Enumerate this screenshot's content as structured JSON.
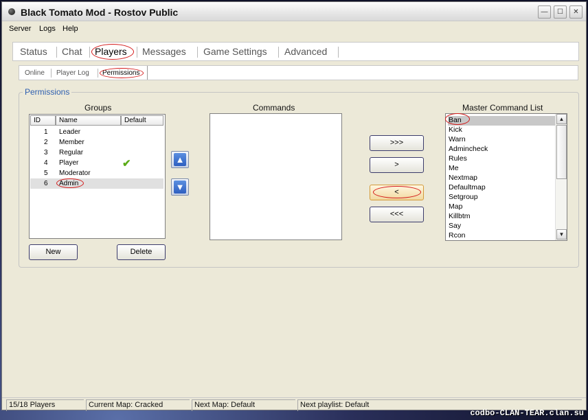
{
  "window": {
    "title": "Black Tomato Mod - Rostov Public",
    "min_glyph": "—",
    "max_glyph": "☐",
    "close_glyph": "✕"
  },
  "menu": [
    "Server",
    "Logs",
    "Help"
  ],
  "main_tabs": [
    "Status",
    "Chat",
    "Players",
    "Messages",
    "Game Settings",
    "Advanced"
  ],
  "sub_tabs": [
    "Online",
    "Player Log",
    "Permissions"
  ],
  "permissions": {
    "legend": "Permissions",
    "groups": {
      "label": "Groups",
      "columns": [
        "ID",
        "Name",
        "Default"
      ],
      "rows": [
        {
          "id": "1",
          "name": "Leader",
          "default": false
        },
        {
          "id": "2",
          "name": "Member",
          "default": false
        },
        {
          "id": "3",
          "name": "Regular",
          "default": false
        },
        {
          "id": "4",
          "name": "Player",
          "default": true
        },
        {
          "id": "5",
          "name": "Moderator",
          "default": false
        },
        {
          "id": "6",
          "name": "Admin",
          "default": false
        }
      ],
      "selected_row": 5,
      "check_glyph": "✔",
      "up_glyph": "▲",
      "down_glyph": "▼",
      "new_label": "New",
      "delete_label": "Delete"
    },
    "commands": {
      "label": "Commands",
      "items": []
    },
    "transfer_buttons": [
      ">>>",
      ">",
      "<",
      "<<<"
    ],
    "master": {
      "label": "Master Command List",
      "items": [
        "Ban",
        "Kick",
        "Warn",
        "Admincheck",
        "Rules",
        "Me",
        "Nextmap",
        "Defaultmap",
        "Setgroup",
        "Map",
        "Killbtm",
        "Say",
        "Rcon"
      ],
      "selected_index": 0,
      "scroll_up_glyph": "▲",
      "scroll_down_glyph": "▼"
    }
  },
  "statusbar": {
    "players": "15/18 Players",
    "current_map": "Current Map: Cracked",
    "next_map": "Next Map: Default",
    "next_playlist": "Next playlist: Default"
  },
  "watermark": "codbo-CLAN-TEAR.clan.su"
}
